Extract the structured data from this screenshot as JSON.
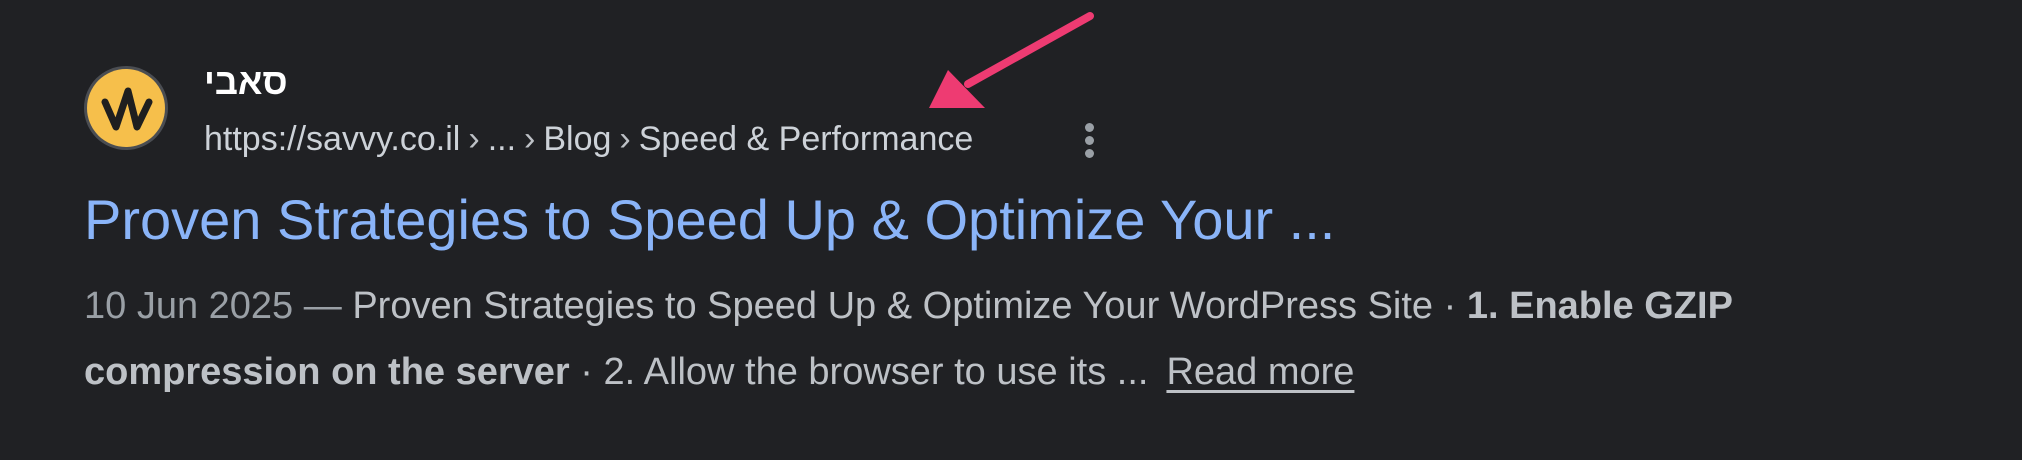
{
  "result": {
    "site_name": "סאבי",
    "favicon_icon": "savvy-logo-icon",
    "breadcrumb": {
      "url": "https://savvy.co.il",
      "items": [
        "...",
        "Blog",
        "Speed & Performance"
      ],
      "separator": "›"
    },
    "more_options_icon": "vertical-dots-icon",
    "title": "Proven Strategies to Speed Up & Optimize Your ...",
    "snippet": {
      "date": "10 Jun 2025",
      "dash": "—",
      "text_1": "Proven Strategies to Speed Up & Optimize Your WordPress Site",
      "dot_1": "·",
      "bold_1": "1. Enable GZIP compression on the server",
      "dot_2": "·",
      "text_2": "2. Allow the browser to use its ...",
      "read_more": "Read more"
    }
  },
  "annotation": {
    "arrow_icon": "pink-arrow-icon",
    "color": "#ee3b72"
  },
  "colors": {
    "background": "#202124",
    "title": "#8ab4f8",
    "favicon": "#f6bf4b"
  }
}
